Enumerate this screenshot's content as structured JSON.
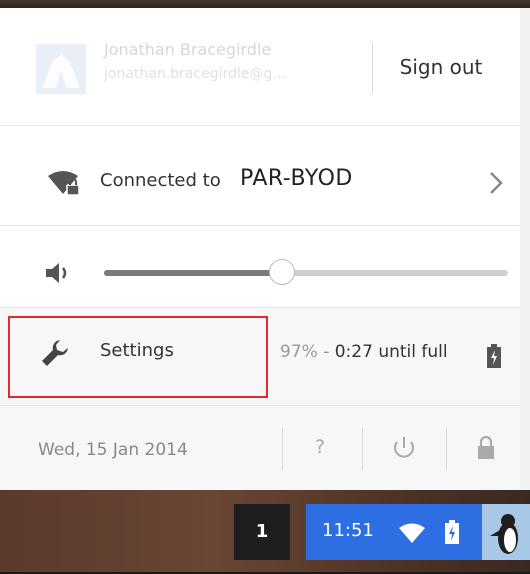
{
  "user": {
    "name": "Jonathan Bracegirdle",
    "email": "jonathan.bracegirdle@g...",
    "sign_out_label": "Sign out"
  },
  "network": {
    "label": "Connected to",
    "name": "PAR-BYOD",
    "icon": "wifi-lock-icon",
    "chevron": "chevron-right-icon"
  },
  "volume": {
    "icon": "speaker-icon",
    "level": 0.44
  },
  "settings": {
    "label": "Settings",
    "icon": "wrench-icon",
    "highlight_color": "#e32a2a"
  },
  "battery": {
    "percent_text": "97% -",
    "time_text": "0:27 until full",
    "icon": "battery-charging-icon"
  },
  "footer": {
    "date": "Wed, 15 Jan 2014",
    "help_label": "?",
    "power_icon": "power-icon",
    "lock_icon": "lock-icon"
  },
  "shelf": {
    "window_count": "1",
    "time": "11:51",
    "tray_color": "#2d6fe3"
  }
}
